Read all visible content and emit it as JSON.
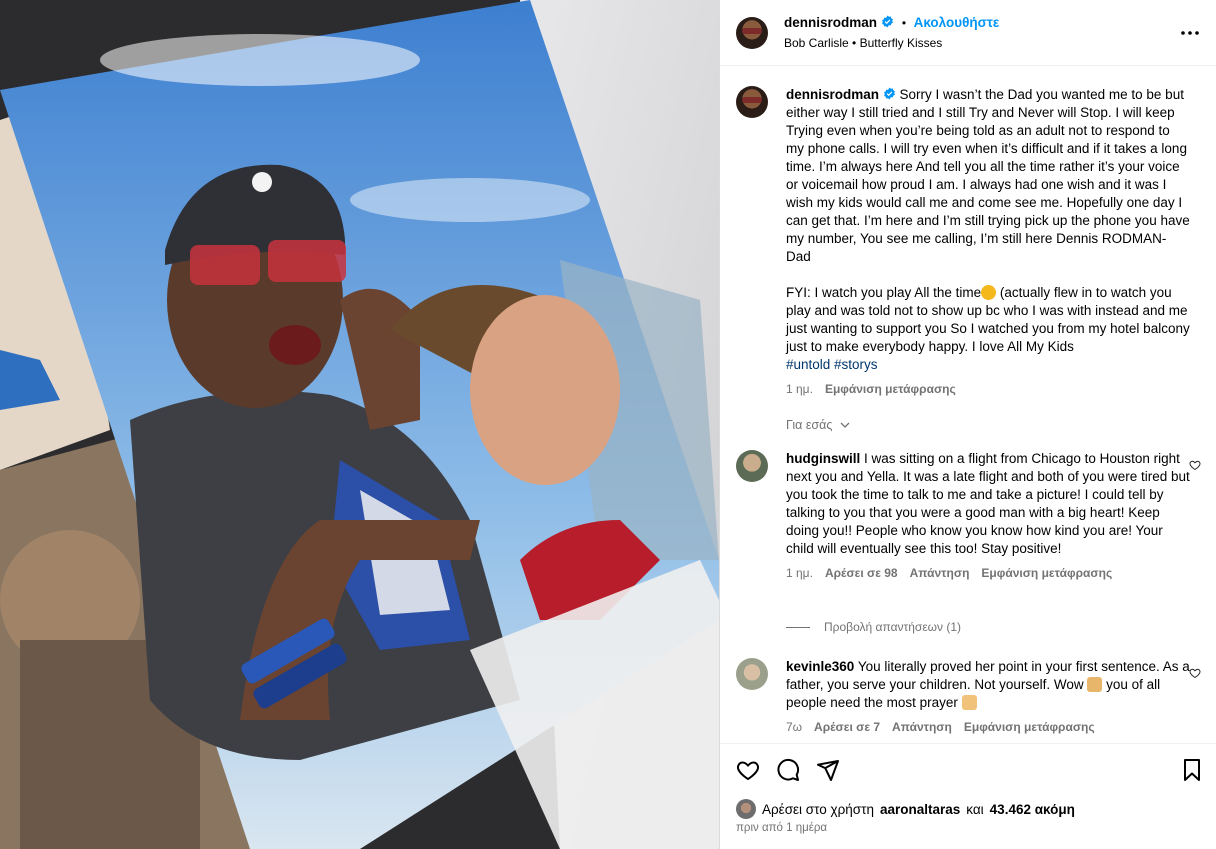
{
  "header": {
    "username": "dennisrodman",
    "follow_label": "Ακολουθήστε",
    "audio_artist": "Bob Carlisle",
    "audio_title": "Butterfly Kisses"
  },
  "caption": {
    "username": "dennisrodman",
    "text": "Sorry I wasn’t the Dad you wanted me to be but either way I still tried and I still Try and Never will Stop. I will keep Trying even when you’re being told as an adult not to respond to my phone calls. I will try even when it’s difficult and if it takes a long time. I’m always here And tell you all the time rather it’s your voice or voicemail how proud I am. I always had one wish and it was I wish my kids would call me and come see me. Hopefully one day I can get that. I’m here and I’m still trying pick up the phone you have my number, You see me calling, I’m still here Dennis RODMAN- Dad",
    "text2_a": "FYI: I watch you play All the time",
    "text2_b": " (actually flew in to watch you play and was told not to show up bc who I was with instead and me just wanting to support you So I watched you from my hotel balcony just to make everybody happy. I love All My Kids",
    "hashtags": "#untold #storys",
    "age": "1 ημ.",
    "see_translation": "Εμφάνιση μετάφρασης"
  },
  "for_you_label": "Για εσάς",
  "comments": [
    {
      "username": "hudginswill",
      "text": "I was sitting on a flight from Chicago to Houston right next you and Yella. It was a late flight and both of you were tired but you took the time to talk to me and take a picture! I could tell by talking to you that you were a good man with a big heart! Keep doing you!! People who know you know how kind you are! Your child will eventually see this too! Stay positive!",
      "age": "1 ημ.",
      "likes": "Αρέσει σε 98",
      "reply": "Απάντηση",
      "see_translation": "Εμφάνιση μετάφρασης",
      "view_replies": "Προβολή απαντήσεων (1)"
    },
    {
      "username": "kevinle360",
      "text_a": "You literally proved her point in your first sentence. As a father, you serve your children. Not yourself. Wow ",
      "text_b": " you of all people need the most prayer ",
      "age": "7ω",
      "likes": "Αρέσει σε 7",
      "reply": "Απάντηση",
      "see_translation": "Εμφάνιση μετάφρασης"
    }
  ],
  "likes": {
    "prefix": "Αρέσει στο χρήστη",
    "user": "aaronaltaras",
    "conj": "και",
    "count": "43.462 ακόμη"
  },
  "posted_ago": "πριν από 1 ημέρα",
  "colors": {
    "accent": "#0095f6",
    "muted": "#737373",
    "hashtag": "#00376b"
  }
}
